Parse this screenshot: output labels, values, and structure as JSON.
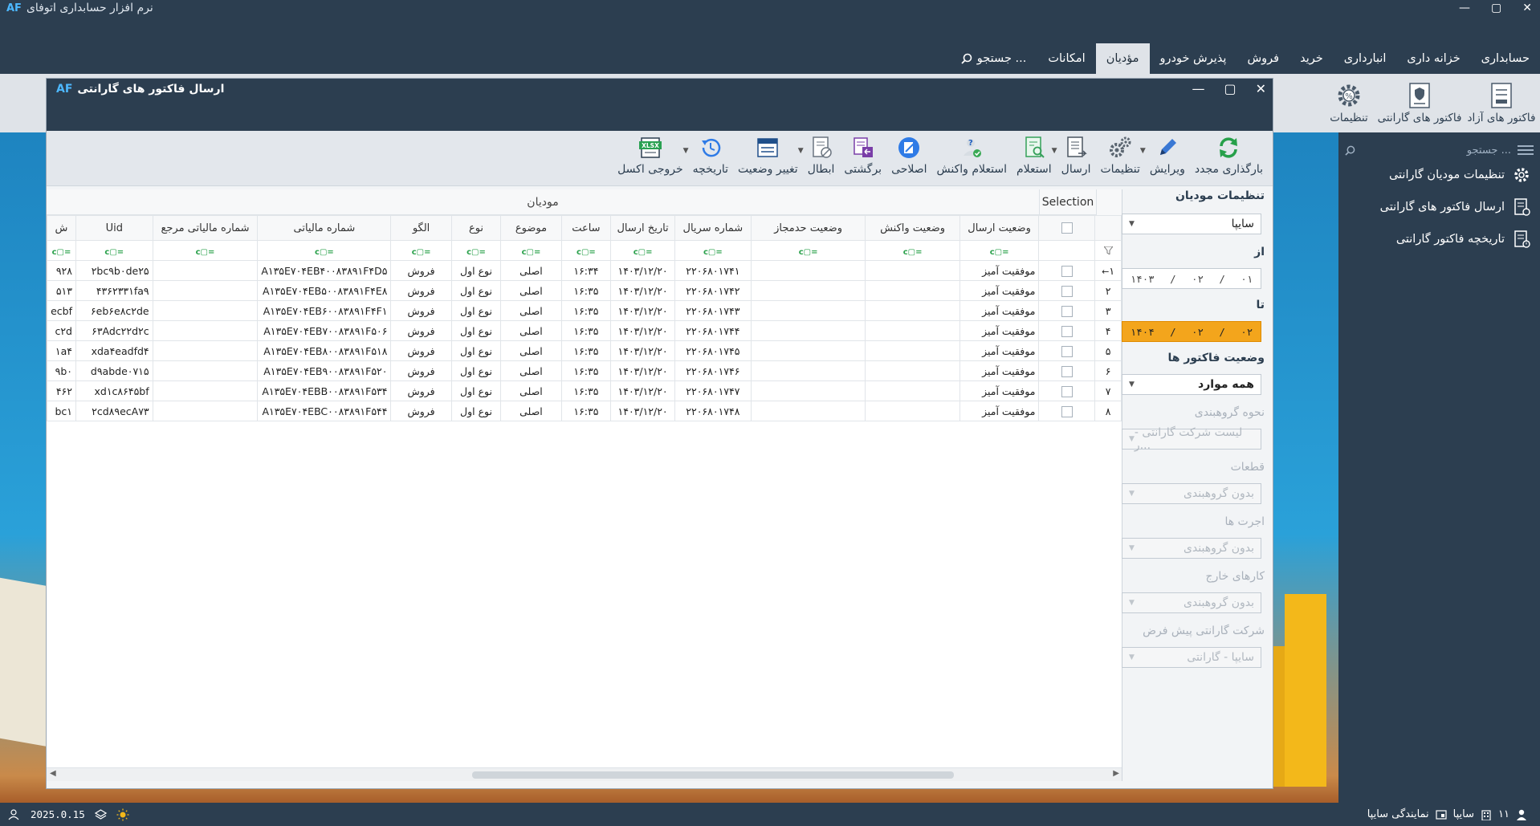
{
  "app": {
    "title": "نرم افزار حسابداری اتوفای",
    "logo": "AF",
    "window_controls": [
      "✕",
      "▢",
      "—"
    ]
  },
  "menu": {
    "items": [
      "حسابداری",
      "خزانه داری",
      "انبارداری",
      "خرید",
      "فروش",
      "پذیرش خودرو",
      "مؤدیان",
      "امکانات"
    ],
    "active": "مؤدیان",
    "search_label": "جستجو ..."
  },
  "ribbon": {
    "buttons": [
      "فاکتور های آزاد",
      "فاکتور های گارانتی",
      "تنظیمات"
    ]
  },
  "right_panel": {
    "search_placeholder": "جستجو ...",
    "items": [
      "تنظیمات مودیان گارانتی",
      "ارسال فاکتور های گارانتی",
      "تاریخچه فاکتور گارانتی"
    ]
  },
  "window": {
    "title": "ارسال فاکتور های گارانتی",
    "toolbar": [
      "بارگذاری مجدد",
      "ویرایش",
      "تنظیمات",
      "ارسال",
      "استعلام",
      "استعلام واکنش",
      "اصلاحی",
      "برگشتی",
      "ابطال",
      "تغییر وضعیت",
      "تاریخچه",
      "خروجی اکسل"
    ]
  },
  "settings": {
    "title": "تنظیمات مودیان",
    "company": "سایپا",
    "from_label": "از",
    "from_date": {
      "day": "۰۱",
      "month": "۰۲",
      "year": "۱۴۰۳"
    },
    "to_label": "تا",
    "to_date": {
      "day": "۰۲",
      "month": "۰۲",
      "year": "۱۴۰۴"
    },
    "status_label": "وضعیت فاکتور ها",
    "status_value": "همه موارد",
    "grouping_label": "نحوه گروهبندی",
    "grouping_value": "لیست شرکت گارانتی - ر...",
    "parts_label": "قطعات",
    "parts_value": "بدون گروهبندی",
    "wages_label": "اجرت ها",
    "wages_value": "بدون گروهبندی",
    "external_label": "کارهای خارج",
    "external_value": "بدون گروهبندی",
    "default_company_label": "شرکت گارانتی پیش فرض",
    "default_company_value": "سایپا - گارانتی"
  },
  "grid": {
    "group_header": "مودیان",
    "selection_header": "Selection",
    "columns": [
      "وضعیت ارسال",
      "وضعیت واکنش",
      "وضعیت حدمجاز",
      "شماره سریال",
      "تاریخ ارسال",
      "ساعت",
      "موضوع",
      "نوع",
      "الگو",
      "شماره مالیاتی",
      "شماره مالیاتی مرجع",
      "Uid",
      "ش"
    ],
    "filter_icon": "=▢c",
    "rows": [
      {
        "no": "۱",
        "arrow": "←",
        "send_status": "موفقیت آمیز",
        "serial": "۲۲۰۶۸۰۱۷۴۱",
        "date": "۱۴۰۳/۱۲/۲۰",
        "time": "۱۶:۳۴",
        "subject": "اصلی",
        "type": "نوع اول",
        "pattern": "فروش",
        "tax_no": "A۱۳۵E۷۰۴EB۴۰۰۸۳۸۹۱F۴D۵",
        "ref_tax_no": "",
        "uid": "۲bc۹b۰de۲۵",
        "extra": "۹۲۸"
      },
      {
        "no": "۲",
        "arrow": "",
        "send_status": "موفقیت آمیز",
        "serial": "۲۲۰۶۸۰۱۷۴۲",
        "date": "۱۴۰۳/۱۲/۲۰",
        "time": "۱۶:۳۵",
        "subject": "اصلی",
        "type": "نوع اول",
        "pattern": "فروش",
        "tax_no": "A۱۳۵E۷۰۴EB۵۰۰۸۳۸۹۱F۴E۸",
        "ref_tax_no": "",
        "uid": "۴۳۶۲۳۳۱fa۹",
        "extra": "۵۱۳"
      },
      {
        "no": "۳",
        "arrow": "",
        "send_status": "موفقیت آمیز",
        "serial": "۲۲۰۶۸۰۱۷۴۳",
        "date": "۱۴۰۳/۱۲/۲۰",
        "time": "۱۶:۳۵",
        "subject": "اصلی",
        "type": "نوع اول",
        "pattern": "فروش",
        "tax_no": "A۱۳۵E۷۰۴EB۶۰۰۸۳۸۹۱F۴F۱",
        "ref_tax_no": "",
        "uid": "۶eb۶e۸c۲de",
        "extra": "ecbf"
      },
      {
        "no": "۴",
        "arrow": "",
        "send_status": "موفقیت آمیز",
        "serial": "۲۲۰۶۸۰۱۷۴۴",
        "date": "۱۴۰۳/۱۲/۲۰",
        "time": "۱۶:۳۵",
        "subject": "اصلی",
        "type": "نوع اول",
        "pattern": "فروش",
        "tax_no": "A۱۳۵E۷۰۴EB۷۰۰۸۳۸۹۱F۵۰۶",
        "ref_tax_no": "",
        "uid": "۶۳Adc۲۲d۲c",
        "extra": "c۲d"
      },
      {
        "no": "۵",
        "arrow": "",
        "send_status": "موفقیت آمیز",
        "serial": "۲۲۰۶۸۰۱۷۴۵",
        "date": "۱۴۰۳/۱۲/۲۰",
        "time": "۱۶:۳۵",
        "subject": "اصلی",
        "type": "نوع اول",
        "pattern": "فروش",
        "tax_no": "A۱۳۵E۷۰۴EB۸۰۰۸۳۸۹۱F۵۱۸",
        "ref_tax_no": "",
        "uid": "xda۴eadfd۴",
        "extra": "۱a۴"
      },
      {
        "no": "۶",
        "arrow": "",
        "send_status": "موفقیت آمیز",
        "serial": "۲۲۰۶۸۰۱۷۴۶",
        "date": "۱۴۰۳/۱۲/۲۰",
        "time": "۱۶:۳۵",
        "subject": "اصلی",
        "type": "نوع اول",
        "pattern": "فروش",
        "tax_no": "A۱۳۵E۷۰۴EB۹۰۰۸۳۸۹۱F۵۲۰",
        "ref_tax_no": "",
        "uid": "d۹abde۰۷۱۵",
        "extra": "۹b۰"
      },
      {
        "no": "۷",
        "arrow": "",
        "send_status": "موفقیت آمیز",
        "serial": "۲۲۰۶۸۰۱۷۴۷",
        "date": "۱۴۰۳/۱۲/۲۰",
        "time": "۱۶:۳۵",
        "subject": "اصلی",
        "type": "نوع اول",
        "pattern": "فروش",
        "tax_no": "A۱۳۵E۷۰۴EBB۰۰۸۳۸۹۱F۵۳۴",
        "ref_tax_no": "",
        "uid": "xd۱c۸۶۴۵bf",
        "extra": "۴۶۲"
      },
      {
        "no": "۸",
        "arrow": "",
        "send_status": "موفقیت آمیز",
        "serial": "۲۲۰۶۸۰۱۷۴۸",
        "date": "۱۴۰۳/۱۲/۲۰",
        "time": "۱۶:۳۵",
        "subject": "اصلی",
        "type": "نوع اول",
        "pattern": "فروش",
        "tax_no": "A۱۳۵E۷۰۴EBC۰۰۸۳۸۹۱F۵۴۴",
        "ref_tax_no": "",
        "uid": "۲cd۸۹ecA۷۳",
        "extra": "bc۱"
      }
    ]
  },
  "status_bar": {
    "version": "2025.0.15",
    "count": "۱۱",
    "company": "سایپا",
    "agency": "نمایندگی سایپا"
  }
}
